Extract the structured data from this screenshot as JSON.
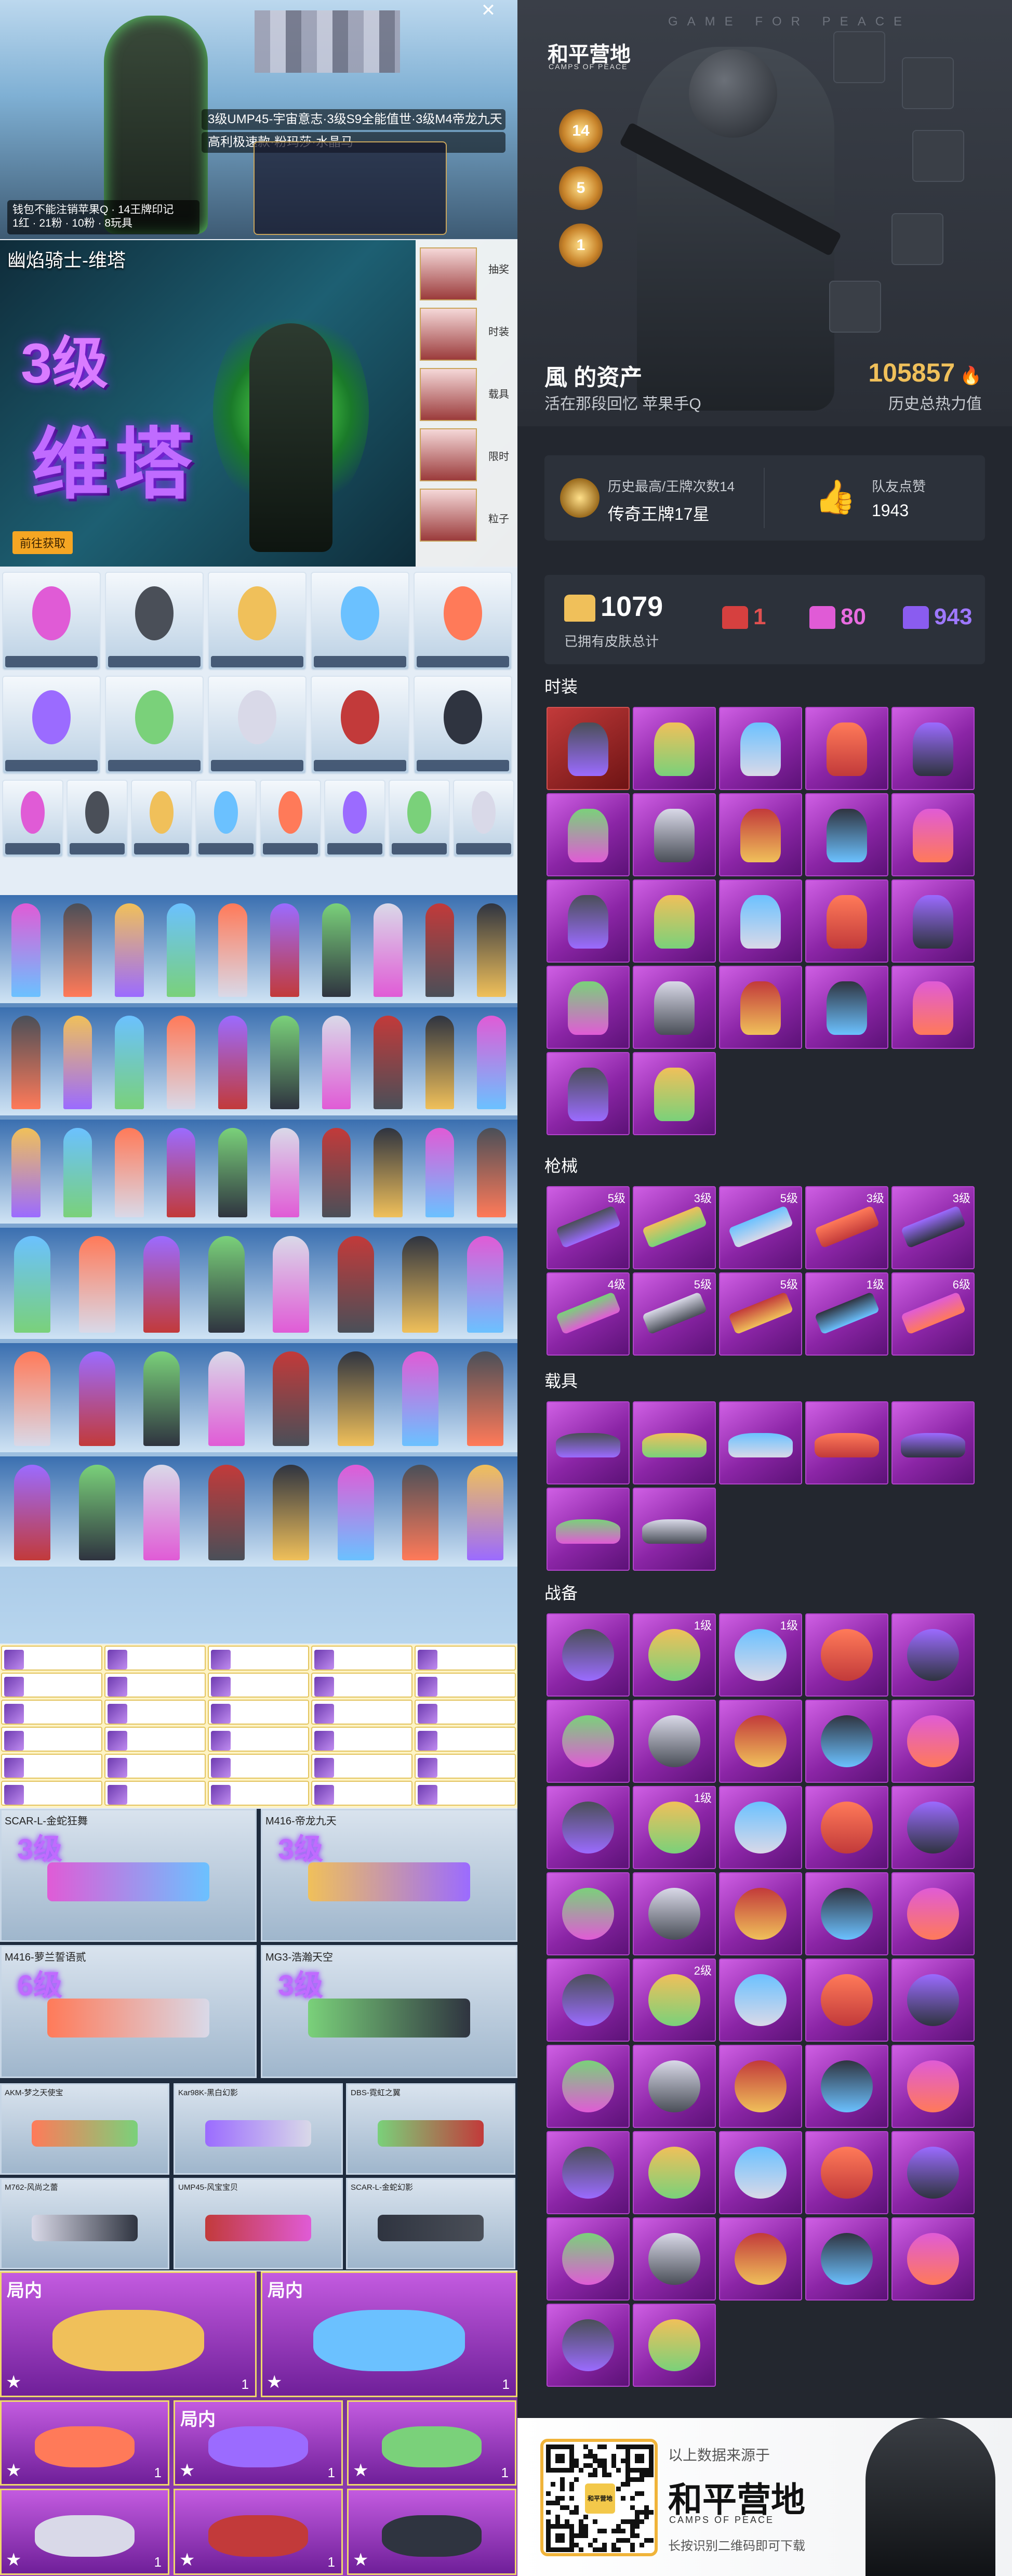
{
  "hero": {
    "close": "✕",
    "tickers": [
      "3级UMP45-宇宙意志·3级S9全能值世·3级M4帝龙九天",
      "高利极速款·粉玛莎·水晶马"
    ],
    "nameplate_line1": "钱包不能注销苹果Q · 14王牌印记",
    "nameplate_line2": "1红 · 21粉 · 10粉 · 8玩具"
  },
  "banner": {
    "title": "幽焰骑士-维塔",
    "level": "3级",
    "name": "维塔",
    "goto": "前往获取",
    "side_nav": [
      "抽奖",
      "时装",
      "载具",
      "限时",
      "粒子"
    ]
  },
  "profile": {
    "game_header": "GAME FOR PEACE",
    "logo": "和平营地",
    "logo_sub": "CAMPS OF PEACE",
    "badges": [
      "14",
      "5",
      "1"
    ],
    "name": "風 的资产",
    "subtitle": "活在那段回忆  苹果手Q",
    "heat_value": "105857",
    "heat_label": "历史总热力值",
    "rank_label": "历史最高/王牌次数14",
    "rank_value": "传奇王牌17星",
    "likes_label": "队友点赞",
    "likes_value": "1943",
    "skins_total": "1079",
    "skins_total_label": "已拥有皮肤总计",
    "red_count": "1",
    "pink_count": "80",
    "purple_count": "943"
  },
  "sections": {
    "outfits": "时装",
    "guns": "枪械",
    "vehicles": "载具",
    "gear": "战备"
  },
  "gun_levels": [
    "5级",
    "3级",
    "5级",
    "3级",
    "3级",
    "4级",
    "5级",
    "5级",
    "1级",
    "6级"
  ],
  "gear_levels": {
    "1": "1级",
    "2": "1级",
    "11": "1级",
    "21": "2级"
  },
  "weapons_left": [
    {
      "name": "SCAR-L-金蛇狂舞",
      "level": "3级"
    },
    {
      "name": "M416-帝龙九天",
      "level": "3级"
    },
    {
      "name": "M416-萝兰誓语贰",
      "level": "6级"
    },
    {
      "name": "MG3-浩瀚天空",
      "level": "3级"
    }
  ],
  "weapons_small": [
    "AKM-梦之天使宝",
    "Kar98K-黑白幻影",
    "DBS-霓虹之翼",
    "M762-风尚之蕾",
    "UMP45-风宝宝贝",
    "SCAR-L-金蛇幻影"
  ],
  "vehicle_tags": [
    "局内",
    "局内",
    "局内"
  ],
  "vehicle_counts": [
    "1",
    "1",
    "1",
    "1",
    "1",
    "1",
    "1"
  ],
  "footer": {
    "source": "以上数据来源于",
    "logo": "和平营地",
    "logo_sub": "CAMPS OF PEACE",
    "hint": "长按识别二维码即可下载",
    "qr_logo": "和平营地"
  }
}
